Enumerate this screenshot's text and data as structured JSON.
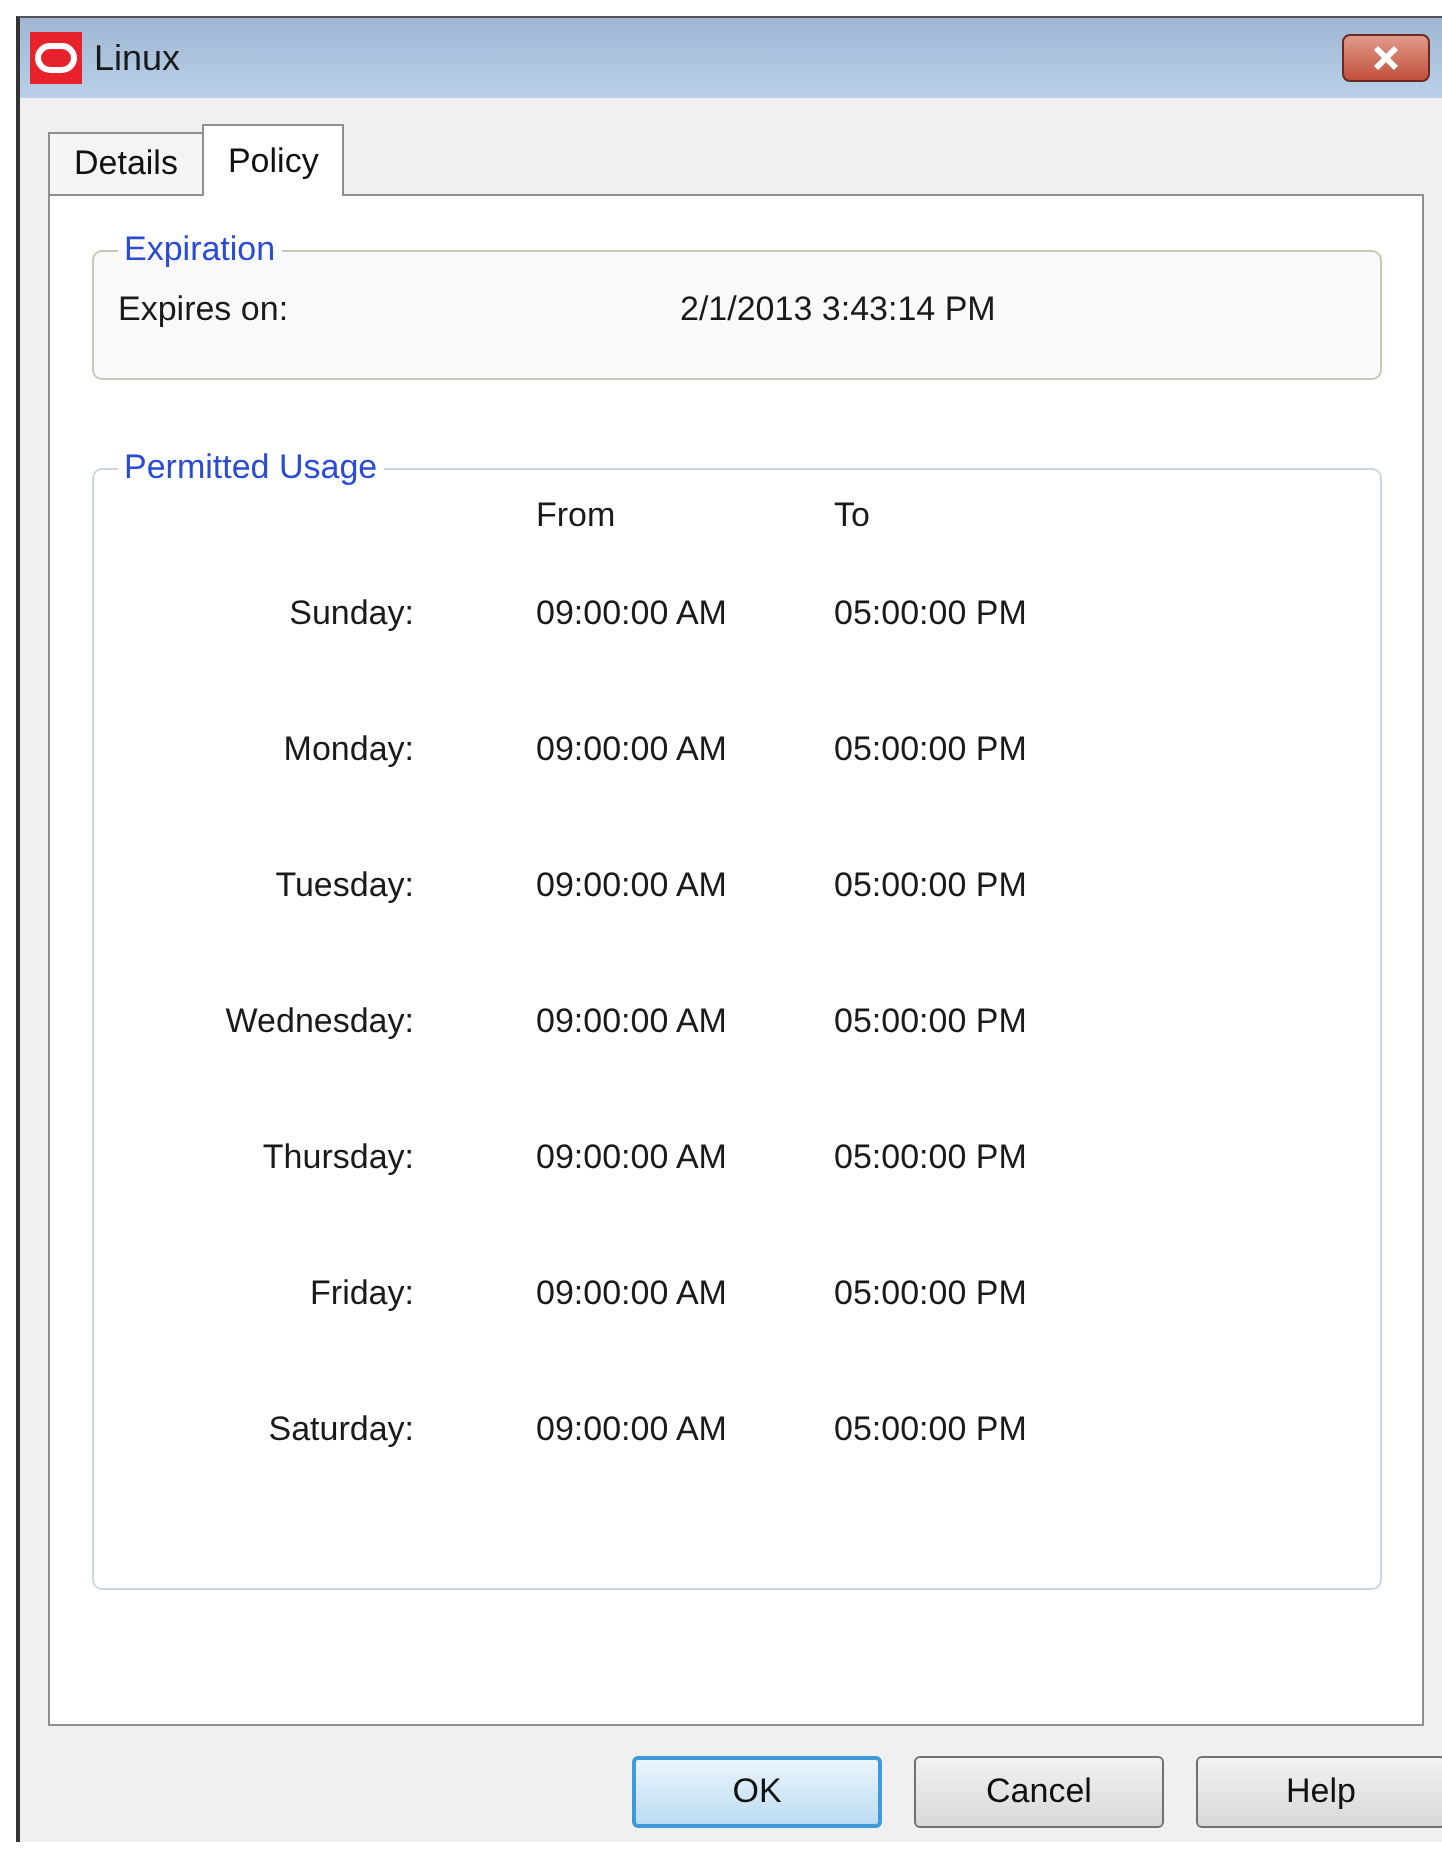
{
  "window": {
    "title": "Linux"
  },
  "tabs": [
    {
      "label": "Details",
      "selected": false
    },
    {
      "label": "Policy",
      "selected": true
    }
  ],
  "expiration": {
    "title": "Expiration",
    "label": "Expires on:",
    "value": "2/1/2013 3:43:14 PM"
  },
  "permitted_usage": {
    "title": "Permitted Usage",
    "columns": [
      "From",
      "To"
    ],
    "rows": [
      {
        "day": "Sunday:",
        "from": "09:00:00 AM",
        "to": "05:00:00 PM"
      },
      {
        "day": "Monday:",
        "from": "09:00:00 AM",
        "to": "05:00:00 PM"
      },
      {
        "day": "Tuesday:",
        "from": "09:00:00 AM",
        "to": "05:00:00 PM"
      },
      {
        "day": "Wednesday:",
        "from": "09:00:00 AM",
        "to": "05:00:00 PM"
      },
      {
        "day": "Thursday:",
        "from": "09:00:00 AM",
        "to": "05:00:00 PM"
      },
      {
        "day": "Friday:",
        "from": "09:00:00 AM",
        "to": "05:00:00 PM"
      },
      {
        "day": "Saturday:",
        "from": "09:00:00 AM",
        "to": "05:00:00 PM"
      }
    ]
  },
  "buttons": [
    {
      "label": "OK",
      "default": true
    },
    {
      "label": "Cancel",
      "default": false
    },
    {
      "label": "Help",
      "default": false
    }
  ]
}
